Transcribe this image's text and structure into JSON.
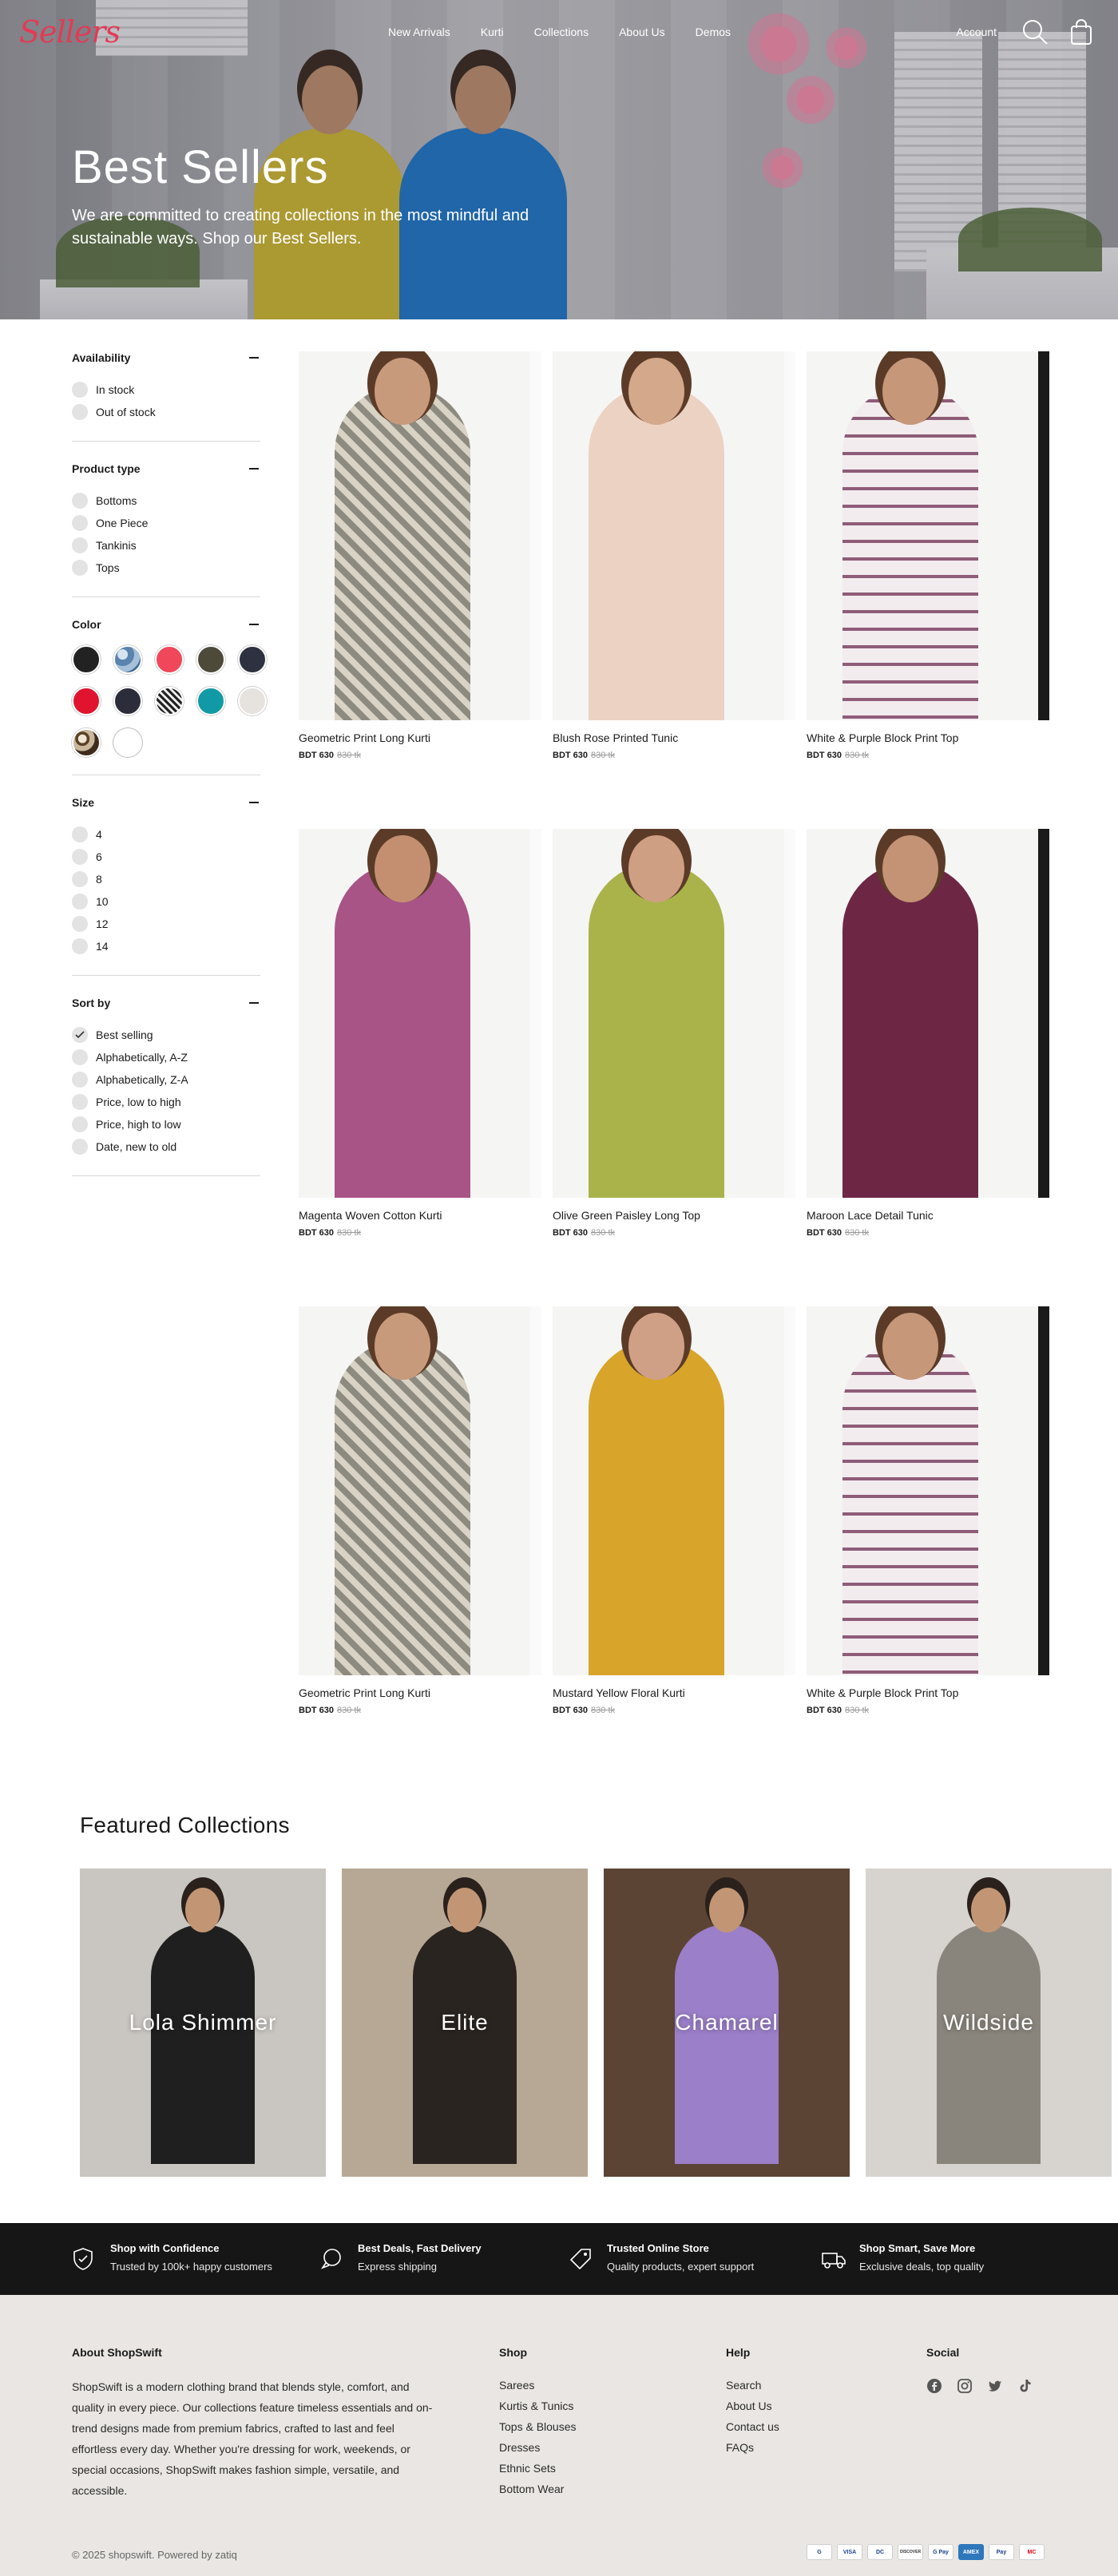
{
  "header": {
    "logo": "Sellers",
    "nav": [
      "New Arrivals",
      "Kurti",
      "Collections",
      "About Us",
      "Demos"
    ],
    "account": "Account"
  },
  "hero": {
    "title": "Best Sellers",
    "subtitle": "We are committed to creating collections in the most mindful and sustainable ways. Shop our Best Sellers."
  },
  "filters": {
    "availability": {
      "title": "Availability",
      "options": [
        "In stock",
        "Out of stock"
      ]
    },
    "product_type": {
      "title": "Product type",
      "options": [
        "Bottoms",
        "One Piece",
        "Tankinis",
        "Tops"
      ]
    },
    "color": {
      "title": "Color",
      "swatches": [
        "#222222",
        "#6f93b8",
        "#f0485a",
        "#4e4a3a",
        "#2e3140",
        "#e0142e",
        "#2b2d3a",
        "#3a3a3a",
        "#119aa6",
        "#e6e2de",
        "#7a5d3b",
        "#ffffff"
      ]
    },
    "size": {
      "title": "Size",
      "options": [
        "4",
        "6",
        "8",
        "10",
        "12",
        "14"
      ]
    },
    "sort": {
      "title": "Sort by",
      "options": [
        "Best selling",
        "Alphabetically, A-Z",
        "Alphabetically, Z-A",
        "Price, low to high",
        "Price, high to low",
        "Date, new to old"
      ],
      "selected": "Best selling"
    }
  },
  "products": [
    {
      "name": "Geometric Print Long Kurti",
      "price": "BDT 630",
      "compare": "830 tk",
      "color": "#9b9a92"
    },
    {
      "name": "Blush Rose Printed Tunic",
      "price": "BDT 630",
      "compare": "830 tk",
      "color": "#ecd2c2"
    },
    {
      "name": "White & Purple Block Print Top",
      "price": "BDT 630",
      "compare": "830 tk",
      "color": "#e4d7db"
    },
    {
      "name": "Magenta Woven Cotton Kurti",
      "price": "BDT 630",
      "compare": "830 tk",
      "color": "#a85487"
    },
    {
      "name": "Olive Green Paisley Long Top",
      "price": "BDT 630",
      "compare": "830 tk",
      "color": "#a9b34a"
    },
    {
      "name": "Maroon Lace Detail Tunic",
      "price": "BDT 630",
      "compare": "830 tk",
      "color": "#6d2745"
    },
    {
      "name": "Geometric Print Long Kurti",
      "price": "BDT 630",
      "compare": "830 tk",
      "color": "#9b9a92"
    },
    {
      "name": "Mustard Yellow Floral Kurti",
      "price": "BDT 630",
      "compare": "830 tk",
      "color": "#d8a52a"
    },
    {
      "name": "White & Purple Block Print Top",
      "price": "BDT 630",
      "compare": "830 tk",
      "color": "#e4d7db"
    }
  ],
  "featured": {
    "title": "Featured Collections",
    "items": [
      {
        "label": "Lola Shimmer",
        "bg": "#c9c5c0",
        "outfit": "#1f1f1f"
      },
      {
        "label": "Elite",
        "bg": "#b7a895",
        "outfit": "#2a2420"
      },
      {
        "label": "Chamarel",
        "bg": "#5c4435",
        "outfit": "#9b7fc9"
      },
      {
        "label": "Wildside",
        "bg": "#d7d3ce",
        "outfit": "#8a857c"
      }
    ]
  },
  "trust": [
    {
      "title": "Shop with Confidence",
      "sub": "Trusted by 100k+ happy customers",
      "icon": "shield-check-icon"
    },
    {
      "title": "Best Deals, Fast Delivery",
      "sub": "Express shipping",
      "icon": "chat-bubble-icon"
    },
    {
      "title": "Trusted Online Store",
      "sub": "Quality products, expert support",
      "icon": "tag-icon"
    },
    {
      "title": "Shop Smart, Save More",
      "sub": "Exclusive deals, top quality",
      "icon": "truck-icon"
    }
  ],
  "footer": {
    "about_title": "About ShopSwift",
    "about_text": "ShopSwift is a modern clothing brand that blends style, comfort, and quality in every piece. Our collections feature timeless essentials and on-trend designs made from premium fabrics, crafted to last and feel effortless every day. Whether you're dressing for work, weekends, or special occasions, ShopSwift makes fashion simple, versatile, and accessible.",
    "shop_title": "Shop",
    "shop_links": [
      "Sarees",
      "Kurtis & Tunics",
      "Tops & Blouses",
      "Dresses",
      "Ethnic Sets",
      "Bottom Wear"
    ],
    "help_title": "Help",
    "help_links": [
      "Search",
      "About Us",
      "Contact us",
      "FAQs"
    ],
    "social_title": "Social",
    "social": [
      "facebook-icon",
      "instagram-icon",
      "twitter-icon",
      "tiktok-icon"
    ],
    "copyright": "© 2025 shopswift. Powered by zatiq",
    "payments": [
      "G",
      "VISA",
      "DC",
      "DISCOVER",
      "G Pay",
      "AMEX",
      "Pay",
      "MC"
    ]
  }
}
